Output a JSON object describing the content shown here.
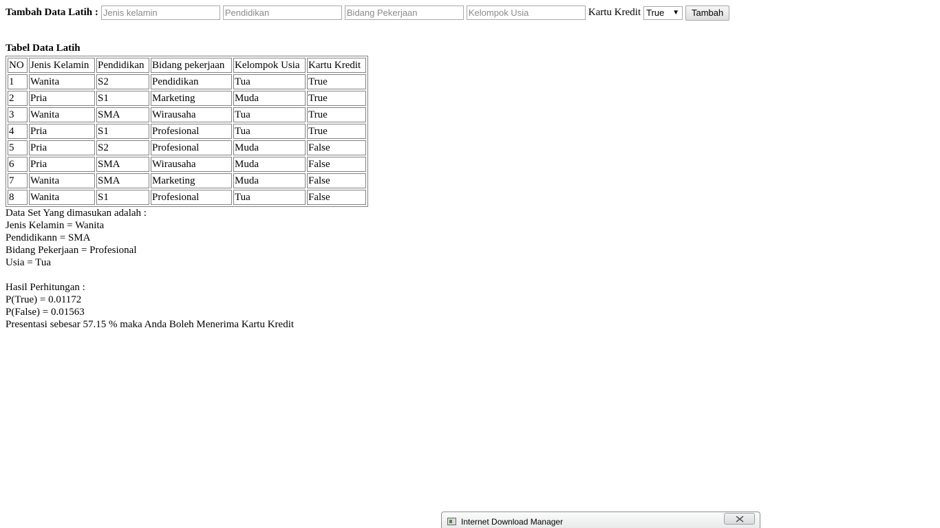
{
  "form": {
    "title": "Tambah Data Latih :",
    "fields": [
      {
        "name": "jenis-kelamin-input",
        "placeholder": "Jenis kelamin",
        "value": ""
      },
      {
        "name": "pendidikan-input",
        "placeholder": "Pendidikan",
        "value": ""
      },
      {
        "name": "bidang-pekerjaan-input",
        "placeholder": "Bidang Pekerjaan",
        "value": ""
      },
      {
        "name": "kelompok-usia-input",
        "placeholder": "Kelompok Usia",
        "value": ""
      }
    ],
    "kartu_kredit_label": "Kartu Kredit",
    "kartu_kredit_selected": "True",
    "submit_label": "Tambah"
  },
  "table": {
    "title": "Tabel Data Latih",
    "headers": [
      "NO",
      "Jenis Kelamin",
      "Pendidikan",
      "Bidang pekerjaan",
      "Kelompok Usia",
      "Kartu Kredit"
    ],
    "rows": [
      [
        "1",
        "Wanita",
        "S2",
        "Pendidikan",
        "Tua",
        "True"
      ],
      [
        "2",
        "Pria",
        "S1",
        "Marketing",
        "Muda",
        "True"
      ],
      [
        "3",
        "Wanita",
        "SMA",
        "Wirausaha",
        "Tua",
        "True"
      ],
      [
        "4",
        "Pria",
        "S1",
        "Profesional",
        "Tua",
        "True"
      ],
      [
        "5",
        "Pria",
        "S2",
        "Profesional",
        "Muda",
        "False"
      ],
      [
        "6",
        "Pria",
        "SMA",
        "Wirausaha",
        "Muda",
        "False"
      ],
      [
        "7",
        "Wanita",
        "SMA",
        "Marketing",
        "Muda",
        "False"
      ],
      [
        "8",
        "Wanita",
        "S1",
        "Profesional",
        "Tua",
        "False"
      ]
    ]
  },
  "results": {
    "dataset_heading": "Data Set Yang dimasukan adalah :",
    "jenis_kelamin": "Jenis Kelamin = Wanita",
    "pendidikan": "Pendidikann = SMA",
    "bidang_pekerjaan": "Bidang Pekerjaan = Profesional",
    "usia": "Usia = Tua",
    "hasil_heading": "Hasil Perhitungan :",
    "p_true": "P(True) = 0.01172",
    "p_false": "P(False) = 0.01563",
    "conclusion": "Presentasi sebesar 57.15 % maka Anda Boleh Menerima Kartu Kredit"
  },
  "taskbar": {
    "idm_title": "Internet Download Manager",
    "icon": "idm-app-icon",
    "close_icon": "close-icon"
  }
}
